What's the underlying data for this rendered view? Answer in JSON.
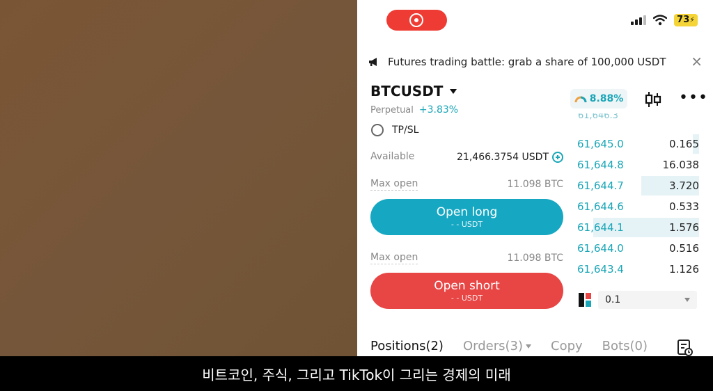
{
  "status_bar": {
    "battery": "73"
  },
  "banner": {
    "text": "Futures trading battle: grab a share of 100,000 USDT",
    "close": "×"
  },
  "pair": {
    "symbol": "BTCUSDT",
    "type": "Perpetual",
    "change": "+3.83%",
    "gauge_pct": "8.88%"
  },
  "tpsl_label": "TP/SL",
  "available": {
    "label": "Available",
    "value": "21,466.3754 USDT"
  },
  "long": {
    "max_label": "Max open",
    "max_value": "11.098 BTC",
    "button": "Open long",
    "sub": "- - USDT"
  },
  "short": {
    "max_label": "Max open",
    "max_value": "11.098 BTC",
    "button": "Open short",
    "sub": "- - USDT"
  },
  "orderbook": {
    "cut_price": "61,646.3",
    "rows": [
      {
        "price": "61,645.0",
        "qty": "0.165",
        "depth": 0.05
      },
      {
        "price": "61,644.8",
        "qty": "16.038",
        "depth": 0.0
      },
      {
        "price": "61,644.7",
        "qty": "3.720",
        "depth": 0.46
      },
      {
        "price": "61,644.6",
        "qty": "0.533",
        "depth": 0.0
      },
      {
        "price": "61,644.1",
        "qty": "1.576",
        "depth": 0.84
      },
      {
        "price": "61,644.0",
        "qty": "0.516",
        "depth": 0.0
      },
      {
        "price": "61,643.4",
        "qty": "1.126",
        "depth": 0.0
      }
    ],
    "depth_value": "0.1"
  },
  "tabs": {
    "positions": "Positions(2)",
    "orders": "Orders(3)",
    "copy": "Copy",
    "bots": "Bots(0)"
  },
  "subtitle": "비트코인, 주식, 그리고 TikTok이 그리는 경제의 미래",
  "colors": {
    "accent": "#16a8c2",
    "short": "#e84545",
    "record": "#ee3b33"
  }
}
